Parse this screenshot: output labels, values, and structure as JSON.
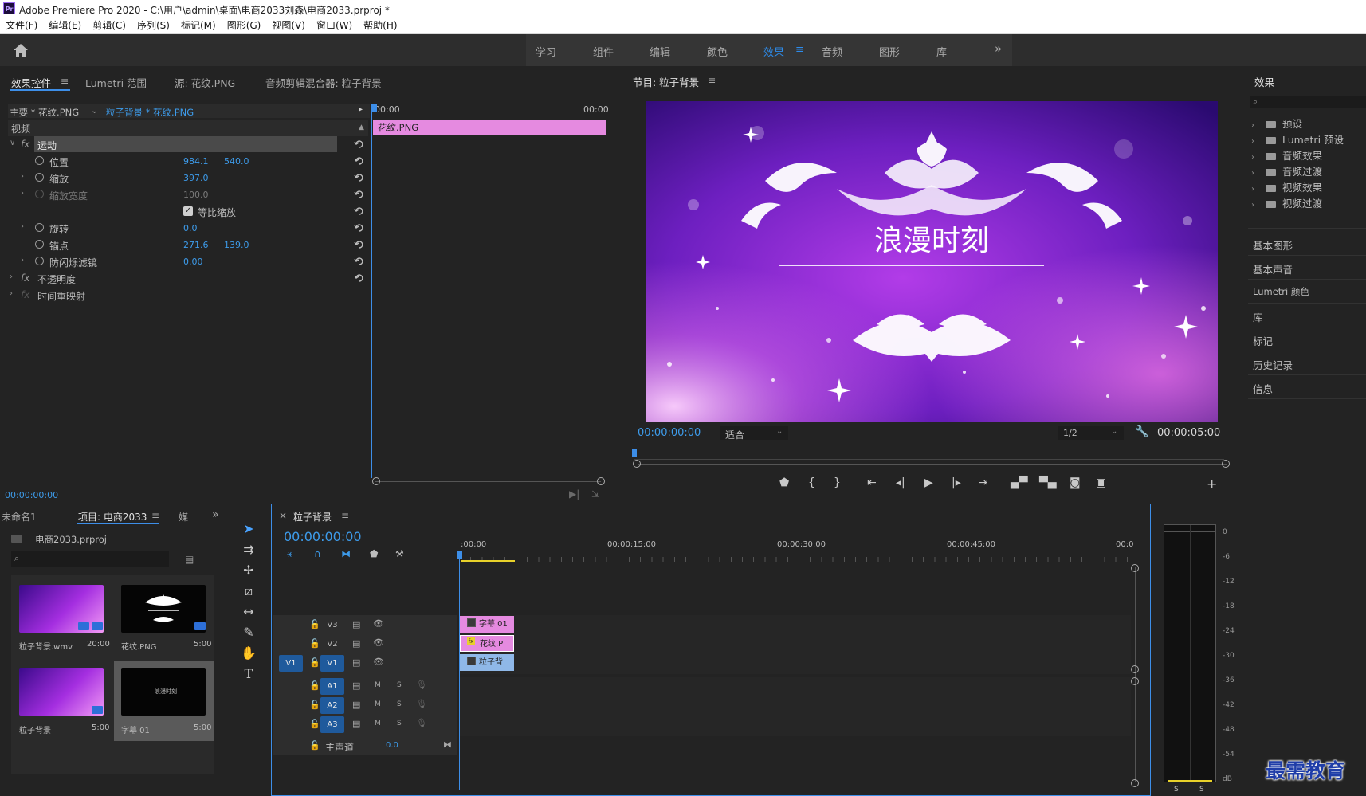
{
  "app": {
    "title": "Adobe Premiere Pro 2020 - C:\\用户\\admin\\桌面\\电商2033刘森\\电商2033.prproj *",
    "logo": "Pr"
  },
  "menu": [
    "文件(F)",
    "编辑(E)",
    "剪辑(C)",
    "序列(S)",
    "标记(M)",
    "图形(G)",
    "视图(V)",
    "窗口(W)",
    "帮助(H)"
  ],
  "workspaces": {
    "items": [
      "学习",
      "组件",
      "编辑",
      "颜色",
      "效果",
      "音频",
      "图形",
      "库"
    ],
    "active": "效果",
    "more": "»"
  },
  "effect_controls": {
    "tabs": [
      "效果控件",
      "Lumetri 范围",
      "源: 花纹.PNG",
      "音频剪辑混合器: 粒子背景"
    ],
    "master": "主要 * 花纹.PNG",
    "sequence": "粒子背景 * 花纹.PNG",
    "section": "视频",
    "motion": "运动",
    "position": {
      "label": "位置",
      "x": "984.1",
      "y": "540.0"
    },
    "scale": {
      "label": "缩放",
      "value": "397.0"
    },
    "scale_width": {
      "label": "缩放宽度",
      "value": "100.0"
    },
    "uniform_scale": "等比缩放",
    "rotation": {
      "label": "旋转",
      "value": "0.0"
    },
    "anchor": {
      "label": "锚点",
      "x": "271.6",
      "y": "139.0"
    },
    "antiflicker": {
      "label": "防闪烁滤镜",
      "value": "0.00"
    },
    "opacity": "不透明度",
    "time_remap": "时间重映射",
    "fx": "fx",
    "time_start": "00:00",
    "time_end": "00:00",
    "clip_name": "花纹.PNG",
    "timecode": "00:00:00:00"
  },
  "program": {
    "title": "节目: 粒子背景",
    "overlay_title": "浪漫时刻",
    "timecode": "00:00:00:00",
    "fit": "适合",
    "resolution": "1/2",
    "duration": "00:00:05:00"
  },
  "effects_panel": {
    "title": "效果",
    "search_placeholder": "",
    "items": [
      "预设",
      "Lumetri 预设",
      "音频效果",
      "音频过渡",
      "视频效果",
      "视频过渡"
    ],
    "panels": [
      "基本图形",
      "基本声音",
      "Lumetri 颜色",
      "库",
      "标记",
      "历史记录",
      "信息"
    ]
  },
  "project": {
    "tabs": [
      "未命名1",
      "项目: 电商2033",
      "媒"
    ],
    "file": "电商2033.prproj",
    "items": [
      {
        "name": "粒子背景.wmv",
        "duration": "20:00"
      },
      {
        "name": "花纹.PNG",
        "duration": "5:00"
      },
      {
        "name": "粒子背景",
        "duration": "5:00"
      },
      {
        "name": "字幕 01",
        "duration": "5:00"
      }
    ],
    "thumb4_text": "浪漫时刻"
  },
  "timeline": {
    "title": "粒子背景",
    "timecode": "00:00:00:00",
    "ruler": [
      ":00:00",
      "00:00:15:00",
      "00:00:30:00",
      "00:00:45:00",
      "00:0"
    ],
    "tracks_video": [
      "V3",
      "V2",
      "V1"
    ],
    "tracks_audio": [
      "A1",
      "A2",
      "A3"
    ],
    "source_patch": "V1",
    "master": {
      "label": "主声道",
      "value": "0.0"
    },
    "mute": "M",
    "solo": "S",
    "clips": {
      "v3": "字幕 01",
      "v2": "花纹.P",
      "v1": "粒子背"
    }
  },
  "audio_meter": {
    "scale": [
      "0",
      "-6",
      "-12",
      "-18",
      "-24",
      "-30",
      "-36",
      "-42",
      "-48",
      "-54",
      "dB"
    ],
    "channels": [
      "S",
      "S"
    ]
  },
  "watermark": "最需教育",
  "colors": {
    "accent": "#2d8ceb",
    "clip_pink": "#e58ae0",
    "clip_blue": "#8fb8e8",
    "panel_bg": "#232323"
  }
}
